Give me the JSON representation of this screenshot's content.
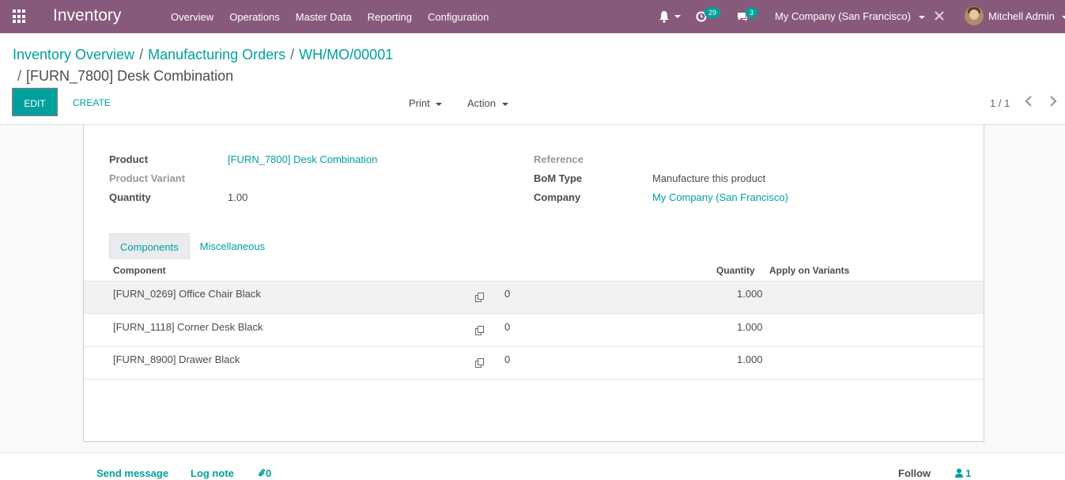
{
  "navbar": {
    "app_name": "Inventory",
    "menu": [
      "Overview",
      "Operations",
      "Master Data",
      "Reporting",
      "Configuration"
    ],
    "activity_count": "29",
    "message_count": "3",
    "company": "My Company (San Francisco)",
    "user": "Mitchell Admin",
    "accent": "#875a7b"
  },
  "breadcrumb": {
    "items": [
      "Inventory Overview",
      "Manufacturing Orders",
      "WH/MO/00001"
    ],
    "current": "[FURN_7800] Desk Combination"
  },
  "toolbar": {
    "edit_label": "EDIT",
    "create_label": "CREATE",
    "print_label": "Print",
    "action_label": "Action",
    "pager": "1 / 1"
  },
  "form": {
    "product_label": "Product",
    "product_value": "[FURN_7800] Desk Combination",
    "variant_label": "Product Variant",
    "quantity_label": "Quantity",
    "quantity_value": "1.00",
    "reference_label": "Reference",
    "bom_type_label": "BoM Type",
    "bom_type_value": "Manufacture this product",
    "company_label": "Company",
    "company_value": "My Company (San Francisco)"
  },
  "tabs": [
    "Components",
    "Miscellaneous"
  ],
  "table": {
    "headers": {
      "component": "Component",
      "quantity": "Quantity",
      "apply": "Apply on Variants"
    },
    "rows": [
      {
        "component": "[FURN_0269] Office Chair Black",
        "zero": "0",
        "quantity": "1.000"
      },
      {
        "component": "[FURN_1118] Corner Desk Black",
        "zero": "0",
        "quantity": "1.000"
      },
      {
        "component": "[FURN_8900] Drawer Black",
        "zero": "0",
        "quantity": "1.000"
      }
    ]
  },
  "chatter": {
    "send_message": "Send message",
    "log_note": "Log note",
    "attachments": "0",
    "follow": "Follow",
    "followers": "1"
  }
}
